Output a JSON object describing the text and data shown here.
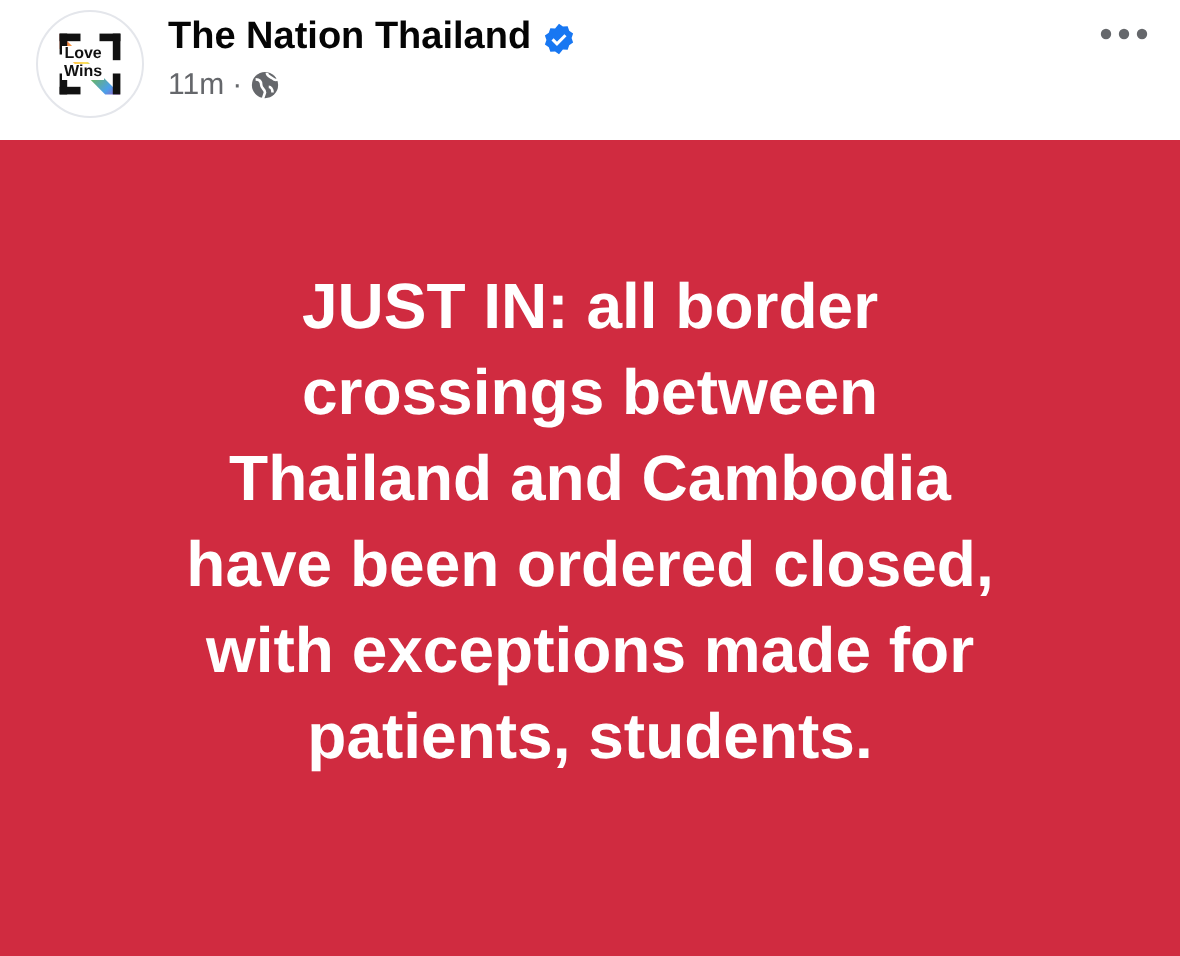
{
  "post": {
    "author": "The Nation Thailand",
    "verified": true,
    "time": "11m",
    "separator": "·",
    "avatar_text": [
      "Love",
      "Wins"
    ],
    "message": "JUST IN: all border\ncrossings between\nThailand and Cambodia\nhave been ordered closed,\nwith exceptions made for\npatients, students."
  }
}
